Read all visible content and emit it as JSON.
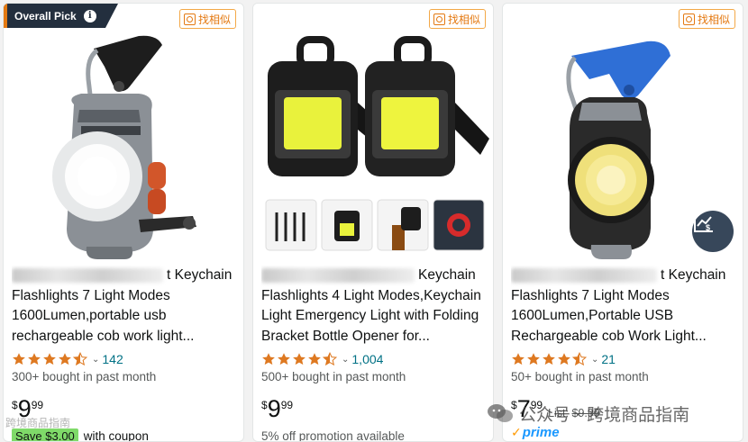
{
  "similar_label": "找相似",
  "badge_label": "Overall Pick",
  "products": [
    {
      "title_visible": "t Keychain Flashlights 7 Light Modes 1600Lumen,portable usb rechargeable cob work light...",
      "title_line1": "t Keychain",
      "title_rest": "Flashlights 7 Light Modes 1600Lumen,portable usb rechargeable cob work light...",
      "rating": 4.5,
      "review_count": "142",
      "bought": "300+ bought in past month",
      "price_currency": "$",
      "price_whole": "9",
      "price_fraction": "99",
      "coupon_tag": "Save $3.00",
      "coupon_text": "with coupon"
    },
    {
      "title_line1": "Keychain",
      "title_rest": "Flashlights 4 Light Modes,Keychain Light Emergency Light with Folding Bracket Bottle Opener for...",
      "rating": 4.5,
      "review_count": "1,004",
      "bought": "500+ bought in past month",
      "price_currency": "$",
      "price_whole": "9",
      "price_fraction": "99",
      "promo": "5% off promotion available"
    },
    {
      "title_line1": "t Keychain",
      "title_rest": "Flashlights 7 Light Modes 1600Lumen,Portable USB Rechargeable cob Work Light...",
      "rating": 4.5,
      "review_count": "21",
      "bought": "50+ bought in past month",
      "price_currency": "$",
      "price_whole": "7",
      "price_fraction": "99",
      "list_price_label": "List:",
      "list_price": "$9.99",
      "prime_label": "prime"
    }
  ],
  "watermark": {
    "text": "公众号 · 跨境商品指南",
    "overlay": "跨境商品指南"
  },
  "colors": {
    "star": "#de7921",
    "link": "#007185",
    "badge_bg": "#232f3e",
    "accent": "#e47911",
    "prime": "#1a98ff",
    "coupon": "#7fda69"
  }
}
